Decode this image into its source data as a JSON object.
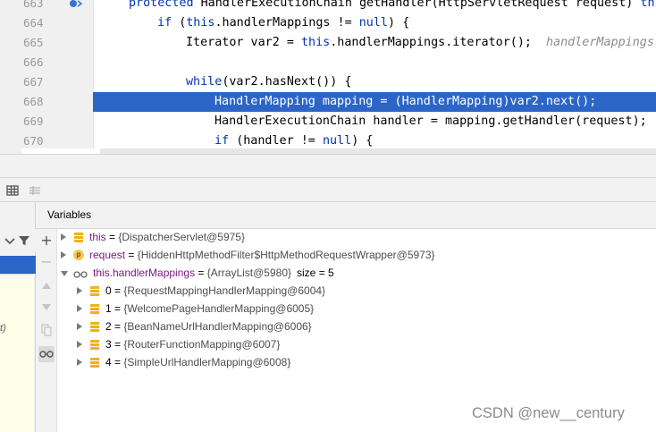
{
  "editor": {
    "lines": [
      {
        "num": "663",
        "indent": 0,
        "parts": [
          {
            "t": "protected ",
            "k": true
          },
          {
            "t": "HandlerExecutionChain getHandler(HttpServletRequest request) ",
            "k": false
          },
          {
            "t": "thr",
            "k": true
          }
        ]
      },
      {
        "num": "664",
        "indent": 1,
        "parts": [
          {
            "t": "if ",
            "k": true
          },
          {
            "t": "(",
            "k": false
          },
          {
            "t": "this",
            "k": true
          },
          {
            "t": ".handlerMappings != ",
            "k": false
          },
          {
            "t": "null",
            "k": true
          },
          {
            "t": ") {",
            "k": false
          }
        ]
      },
      {
        "num": "665",
        "indent": 2,
        "parts": [
          {
            "t": "Iterator var2 = ",
            "k": false
          },
          {
            "t": "this",
            "k": true
          },
          {
            "t": ".handlerMappings.iterator();",
            "k": false
          }
        ],
        "hint": "handlerMappings:"
      },
      {
        "num": "666",
        "indent": 0,
        "parts": []
      },
      {
        "num": "667",
        "indent": 2,
        "parts": [
          {
            "t": "while",
            "k": true
          },
          {
            "t": "(var2.hasNext()) {",
            "k": false
          }
        ]
      },
      {
        "num": "668",
        "indent": 3,
        "current": true,
        "parts": [
          {
            "t": "HandlerMapping mapping = (HandlerMapping)var2.next();",
            "k": false
          }
        ]
      },
      {
        "num": "669",
        "indent": 3,
        "parts": [
          {
            "t": "HandlerExecutionChain handler = mapping.getHandler(request);",
            "k": false
          }
        ]
      },
      {
        "num": "670",
        "indent": 3,
        "parts": [
          {
            "t": "if ",
            "k": true
          },
          {
            "t": "(handler != ",
            "k": false
          },
          {
            "t": "null",
            "k": true
          },
          {
            "t": ") {",
            "k": false
          }
        ]
      }
    ]
  },
  "variables": {
    "title": "Variables",
    "items": [
      {
        "name": "this",
        "value": "{DispatcherServlet@5975}",
        "icon": "field",
        "expanded": false,
        "level": 0
      },
      {
        "name": "request",
        "value": "{HiddenHttpMethodFilter$HttpMethodRequestWrapper@5973}",
        "icon": "param",
        "expanded": false,
        "level": 0
      },
      {
        "name": "this.handlerMappings",
        "value": "{ArrayList@5980}",
        "extra": "size = 5",
        "icon": "watch",
        "expanded": true,
        "level": 0
      },
      {
        "name": "0",
        "value": "{RequestMappingHandlerMapping@6004}",
        "icon": "field",
        "expanded": false,
        "level": 1
      },
      {
        "name": "1",
        "value": "{WelcomePageHandlerMapping@6005}",
        "icon": "field",
        "expanded": false,
        "level": 1
      },
      {
        "name": "2",
        "value": "{BeanNameUrlHandlerMapping@6006}",
        "icon": "field",
        "expanded": false,
        "level": 1
      },
      {
        "name": "3",
        "value": "{RouterFunctionMapping@6007}",
        "icon": "field",
        "expanded": false,
        "level": 1
      },
      {
        "name": "4",
        "value": "{SimpleUrlHandlerMapping@6008}",
        "icon": "field",
        "expanded": false,
        "level": 1
      }
    ]
  },
  "frames": {
    "partial_text": "t)"
  },
  "toolbar": {
    "icons": [
      "table-icon",
      "restore-layout-icon"
    ],
    "vertical": [
      "add-icon",
      "remove-icon",
      "move-up-icon",
      "move-down-icon",
      "copy-icon",
      "watches-icon"
    ]
  },
  "watermark": "CSDN @new__century"
}
